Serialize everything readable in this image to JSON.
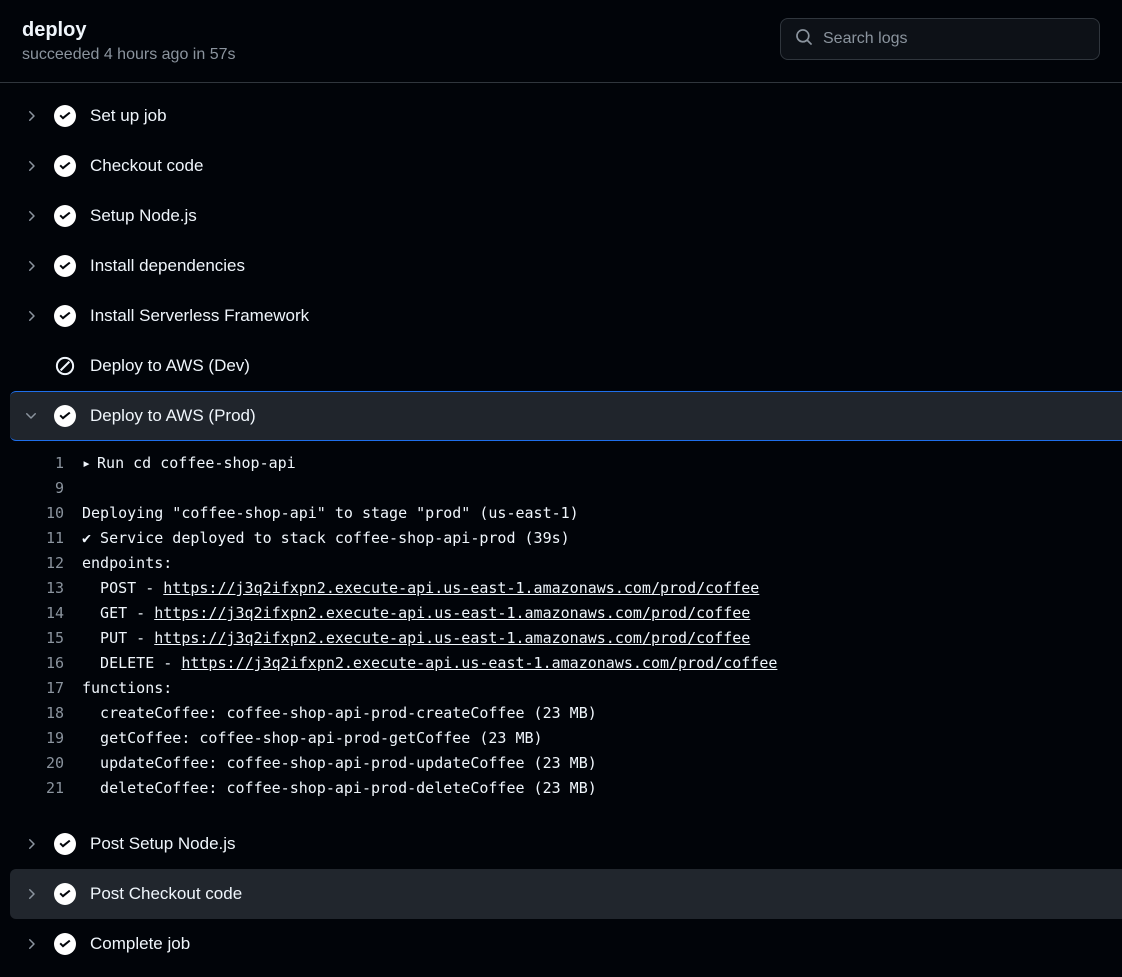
{
  "header": {
    "title": "deploy",
    "subtitle": "succeeded 4 hours ago in 57s"
  },
  "search": {
    "placeholder": "Search logs"
  },
  "steps": [
    {
      "name": "Set up job",
      "status": "success",
      "expanded": false
    },
    {
      "name": "Checkout code",
      "status": "success",
      "expanded": false
    },
    {
      "name": "Setup Node.js",
      "status": "success",
      "expanded": false
    },
    {
      "name": "Install dependencies",
      "status": "success",
      "expanded": false
    },
    {
      "name": "Install Serverless Framework",
      "status": "success",
      "expanded": false
    },
    {
      "name": "Deploy to AWS (Dev)",
      "status": "skipped",
      "expanded": false
    },
    {
      "name": "Deploy to AWS (Prod)",
      "status": "success",
      "expanded": true,
      "selected": true
    },
    {
      "name": "Post Setup Node.js",
      "status": "success",
      "expanded": false
    },
    {
      "name": "Post Checkout code",
      "status": "success",
      "expanded": false,
      "hovered": true
    },
    {
      "name": "Complete job",
      "status": "success",
      "expanded": false
    }
  ],
  "log": {
    "run_line": {
      "num": "1",
      "text": "Run cd coffee-shop-api"
    },
    "lines": [
      {
        "num": "9",
        "text": ""
      },
      {
        "num": "10",
        "text": "Deploying \"coffee-shop-api\" to stage \"prod\" (us-east-1)"
      },
      {
        "num": "11",
        "text": "✔ Service deployed to stack coffee-shop-api-prod (39s)"
      },
      {
        "num": "12",
        "text": "endpoints:"
      },
      {
        "num": "13",
        "prefix": "  POST - ",
        "link": "https://j3q2ifxpn2.execute-api.us-east-1.amazonaws.com/prod/coffee"
      },
      {
        "num": "14",
        "prefix": "  GET - ",
        "link": "https://j3q2ifxpn2.execute-api.us-east-1.amazonaws.com/prod/coffee"
      },
      {
        "num": "15",
        "prefix": "  PUT - ",
        "link": "https://j3q2ifxpn2.execute-api.us-east-1.amazonaws.com/prod/coffee"
      },
      {
        "num": "16",
        "prefix": "  DELETE - ",
        "link": "https://j3q2ifxpn2.execute-api.us-east-1.amazonaws.com/prod/coffee"
      },
      {
        "num": "17",
        "text": "functions:"
      },
      {
        "num": "18",
        "text": "  createCoffee: coffee-shop-api-prod-createCoffee (23 MB)"
      },
      {
        "num": "19",
        "text": "  getCoffee: coffee-shop-api-prod-getCoffee (23 MB)"
      },
      {
        "num": "20",
        "text": "  updateCoffee: coffee-shop-api-prod-updateCoffee (23 MB)"
      },
      {
        "num": "21",
        "text": "  deleteCoffee: coffee-shop-api-prod-deleteCoffee (23 MB)"
      }
    ]
  }
}
